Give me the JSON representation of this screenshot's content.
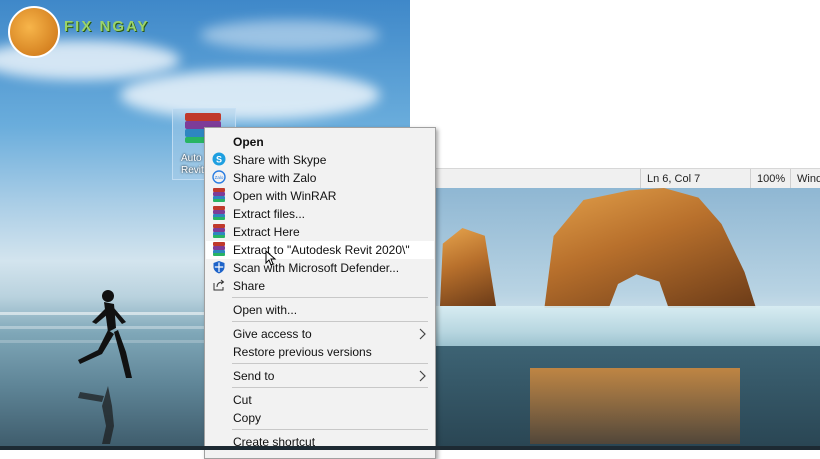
{
  "logo": {
    "text": "FIX NGAY",
    "sub": ""
  },
  "desktop_icon": {
    "label_line1": "Auto",
    "label_line2": "Revit"
  },
  "statusbar": {
    "position": "Ln 6, Col 7",
    "zoom": "100%",
    "encoding": "Wind"
  },
  "context_menu": {
    "items": [
      {
        "label": "Open",
        "icon": "none",
        "bold": true
      },
      {
        "label": "Share with Skype",
        "icon": "skype-icon"
      },
      {
        "label": "Share with Zalo",
        "icon": "zalo-icon"
      },
      {
        "label": "Open with WinRAR",
        "icon": "winrar-icon"
      },
      {
        "label": "Extract files...",
        "icon": "winrar-icon"
      },
      {
        "label": "Extract Here",
        "icon": "winrar-icon"
      },
      {
        "label": "Extract to \"Autodesk Revit 2020\\\"",
        "icon": "winrar-icon",
        "highlighted": true
      },
      {
        "label": "Scan with Microsoft Defender...",
        "icon": "defender-shield-icon"
      },
      {
        "label": "Share",
        "icon": "share-icon"
      },
      {
        "label": "Open with...",
        "icon": "none"
      },
      {
        "label": "Give access to",
        "icon": "none",
        "submenu": true
      },
      {
        "label": "Restore previous versions",
        "icon": "none"
      },
      {
        "label": "Send to",
        "icon": "none",
        "submenu": true
      },
      {
        "label": "Cut",
        "icon": "none"
      },
      {
        "label": "Copy",
        "icon": "none"
      },
      {
        "label": "Create shortcut",
        "icon": "none"
      }
    ]
  },
  "colors": {
    "menu_bg": "#f2f2f2",
    "highlight": "#ffffff",
    "skype": "#1e9fe0",
    "zalo": "#2a7de1",
    "defender": "#1d63c9"
  }
}
